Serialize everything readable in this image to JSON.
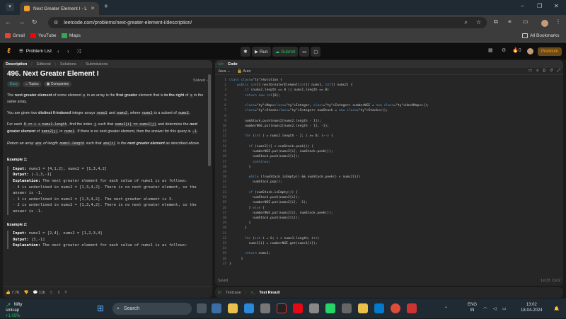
{
  "browser": {
    "tab_title": "Next Greater Element I - LeetC",
    "url": "leetcode.com/problems/next-greater-element-i/description/",
    "bookmarks": [
      "Gmail",
      "YouTube",
      "Maps"
    ],
    "all_bookmarks": "All Bookmarks"
  },
  "lc_header": {
    "problem_list": "Problem List",
    "run": "Run",
    "submit": "Submit",
    "streak": "0",
    "premium": "Premium"
  },
  "left_tabs": [
    "Description",
    "Editorial",
    "Solutions",
    "Submissions"
  ],
  "problem": {
    "title": "496. Next Greater Element I",
    "status": "Solved",
    "difficulty": "Easy",
    "topics": "Topics",
    "companies": "Companies",
    "likes": "7.7K",
    "comments": "116"
  },
  "code_panel": {
    "title": "Code",
    "language": "Java",
    "mode": "Auto",
    "saved": "Saved",
    "cursor": "Ln 37, Col 2",
    "lines": [
      "class Solution {",
      "    public int[] nextGreaterElement(int[] nums1, int[] nums2) {",
      "        if (nums2.length == 0 || nums1.length == 0)",
      "        return new int[0];",
      "",
      "        Map<Integer, Integer> numberNGE = new HashMap<>();",
      "        Stack<Integer> numStack = new Stack<>();",
      "",
      "        numStack.push(nums2[nums2.length - 1]);",
      "        numberNGE.put(nums2[nums2.length - 1], -1);",
      "",
      "        for (int i = nums2.length - 2; i >= 0; i--) {",
      "",
      "          if (nums2[i] < numStack.peek()) {",
      "            numberNGE.put(nums2[i], numStack.peek());",
      "            numStack.push(nums2[i]);",
      "            continue;",
      "          }",
      "",
      "          while (!numStack.isEmpty() && numStack.peek() < nums2[i])",
      "            numStack.pop();",
      "",
      "          if (numStack.isEmpty()) {",
      "            numStack.push(nums2[i]);",
      "            numberNGE.put(nums2[i], -1);",
      "          } else {",
      "            numberNGE.put(nums2[i], numStack.peek());",
      "            numStack.push(nums2[i]);",
      "          }",
      "        }",
      "",
      "        for (int i = 0; i < nums1.length; i++)",
      "          nums1[i] = numberNGE.get(nums1[i]);",
      "",
      "        return nums1;",
      "      }",
      "}"
    ]
  },
  "bottom_tabs": [
    "Testcase",
    "Test Result"
  ],
  "taskbar": {
    "widget_title": "Nifty smlcap",
    "widget_value": "+1.05%",
    "search": "Search",
    "lang1": "ENG",
    "lang2": "IN",
    "time": "13:02",
    "date": "18-04-2024"
  }
}
